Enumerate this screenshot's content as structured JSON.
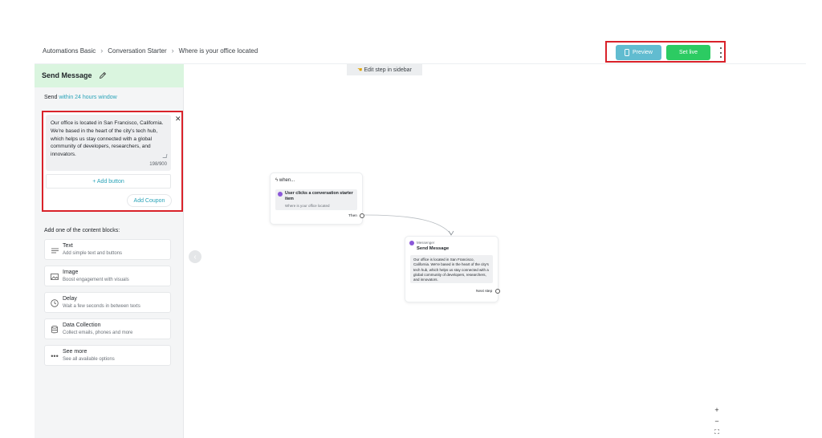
{
  "breadcrumb": [
    "Automations Basic",
    "Conversation Starter",
    "Where is your office located"
  ],
  "header": {
    "preview_label": "Preview",
    "set_live_label": "Set live"
  },
  "sidebar": {
    "title": "Send Message",
    "send_prefix": "Send",
    "send_window": "within 24 hours window",
    "message_text": "Our office is located in San Francisco, California. We're based in the heart of the city's tech hub, which helps us stay connected with a global community of developers, researchers, and innovators.",
    "char_count": "198/900",
    "add_button_label": "+ Add button",
    "add_coupon_label": "Add Coupon",
    "blocks_heading": "Add one of the content blocks:",
    "blocks": [
      {
        "title": "Text",
        "desc": "Add simple text and buttons",
        "icon": "text-lines-icon"
      },
      {
        "title": "Image",
        "desc": "Boost engagement with visuals",
        "icon": "image-icon"
      },
      {
        "title": "Delay",
        "desc": "Wait a few seconds in between texts",
        "icon": "clock-icon"
      },
      {
        "title": "Data Collection",
        "desc": "Collect emails, phones and more",
        "icon": "database-icon"
      },
      {
        "title": "See more",
        "desc": "See all available options",
        "icon": "ellipsis-icon"
      }
    ]
  },
  "canvas": {
    "edit_hint": "Edit step in sidebar",
    "trigger_node": {
      "label": "when...",
      "title": "User clicks a conversation starter item",
      "subtitle": "Where is your office located",
      "port_label": "Then"
    },
    "message_node": {
      "channel": "Messenger",
      "title": "Send Message",
      "text": "Our office is located in San Francisco, California. We're based in the heart of the city's tech hub, which helps us stay connected with a global community of developers, researchers, and innovators.",
      "port_label": "Next step"
    },
    "zoom": {
      "plus": "+",
      "minus": "−",
      "fit": "⛶"
    }
  },
  "colors": {
    "preview": "#61bcd0",
    "set_live": "#2ccb62",
    "sidebar_header": "#daf5df",
    "link": "#2aa3b8",
    "highlight_box": "#d9222a",
    "messenger": "#8b58d9"
  }
}
